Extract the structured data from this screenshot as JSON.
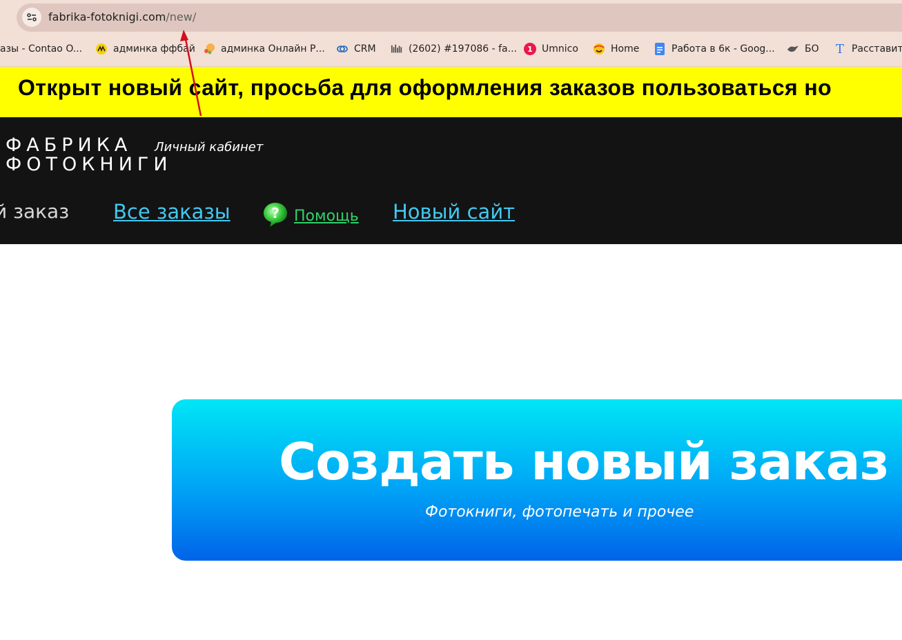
{
  "browser": {
    "url_host": "fabrika-fotoknigi.com",
    "url_path": "/new/",
    "bookmarks": [
      {
        "label": "азы - Contao O...",
        "icon": "none"
      },
      {
        "label": "админка ффбай",
        "icon": "yellow-logo-icon"
      },
      {
        "label": "админка Онлайн Р...",
        "icon": "orange-dots-icon"
      },
      {
        "label": "CRM",
        "icon": "crm-rings-icon"
      },
      {
        "label": "(2602) #197086 - fa...",
        "icon": "bars-icon"
      },
      {
        "label": "Umnico",
        "icon": "red-badge-icon",
        "badge": "1"
      },
      {
        "label": "Home",
        "icon": "smile-icon"
      },
      {
        "label": "Работа в 6к - Goog...",
        "icon": "google-docs-icon"
      },
      {
        "label": "БО",
        "icon": "bird-icon"
      },
      {
        "label": "Расставить",
        "icon": "t-icon",
        "icon_text": "T"
      }
    ]
  },
  "banner": {
    "text": "Открыт новый сайт, просьба для оформления заказов пользоваться но"
  },
  "header": {
    "logo_line1": "ФАБРИКА",
    "logo_line2": "ФОТОКНИГИ",
    "cabinet": "Личный кабинет"
  },
  "nav": {
    "current": "й заказ",
    "all_orders": "Все заказы",
    "help": "Помощь",
    "new_site": "Новый сайт"
  },
  "cta": {
    "title": "Создать новый заказ",
    "subtitle": "Фотокниги, фотопечать и прочее"
  },
  "colors": {
    "banner_bg": "#ffff00",
    "header_bg": "#131313",
    "link": "#41c8f0",
    "help": "#2fd16a",
    "cta_top": "#00e6f6",
    "cta_bottom": "#0063e8",
    "annotation_arrow": "#d0101e"
  }
}
